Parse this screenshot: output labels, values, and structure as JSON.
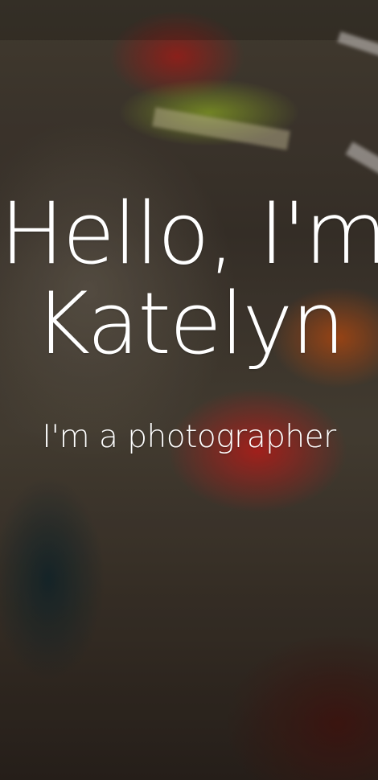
{
  "hero": {
    "headline_line1": "Hello, I'm",
    "headline_line2": "Katelyn",
    "tagline": "I'm a photographer"
  }
}
